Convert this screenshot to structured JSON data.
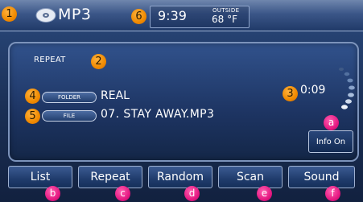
{
  "header": {
    "mode": "MP3",
    "clock": "9:39",
    "outside_label": "OUTSIDE",
    "outside_temp": "68 °F"
  },
  "status": {
    "repeat": "REPEAT",
    "folder_tag": "FOLDER",
    "folder_value": "REAL",
    "file_tag": "FILE",
    "file_value": "07. STAY AWAY.MP3",
    "elapsed": "0:09"
  },
  "info_button": "Info On",
  "buttons": [
    "List",
    "Repeat",
    "Random",
    "Scan",
    "Sound"
  ],
  "callouts": {
    "n1": "1",
    "n2": "2",
    "n3": "3",
    "n4": "4",
    "n5": "5",
    "n6": "6",
    "a": "a",
    "b": "b",
    "c": "c",
    "d": "d",
    "e": "e",
    "f": "f"
  },
  "colors": {
    "number_callout": "#f08a00",
    "letter_callout": "#e3157f",
    "screen_bg": "#1a2f55"
  }
}
